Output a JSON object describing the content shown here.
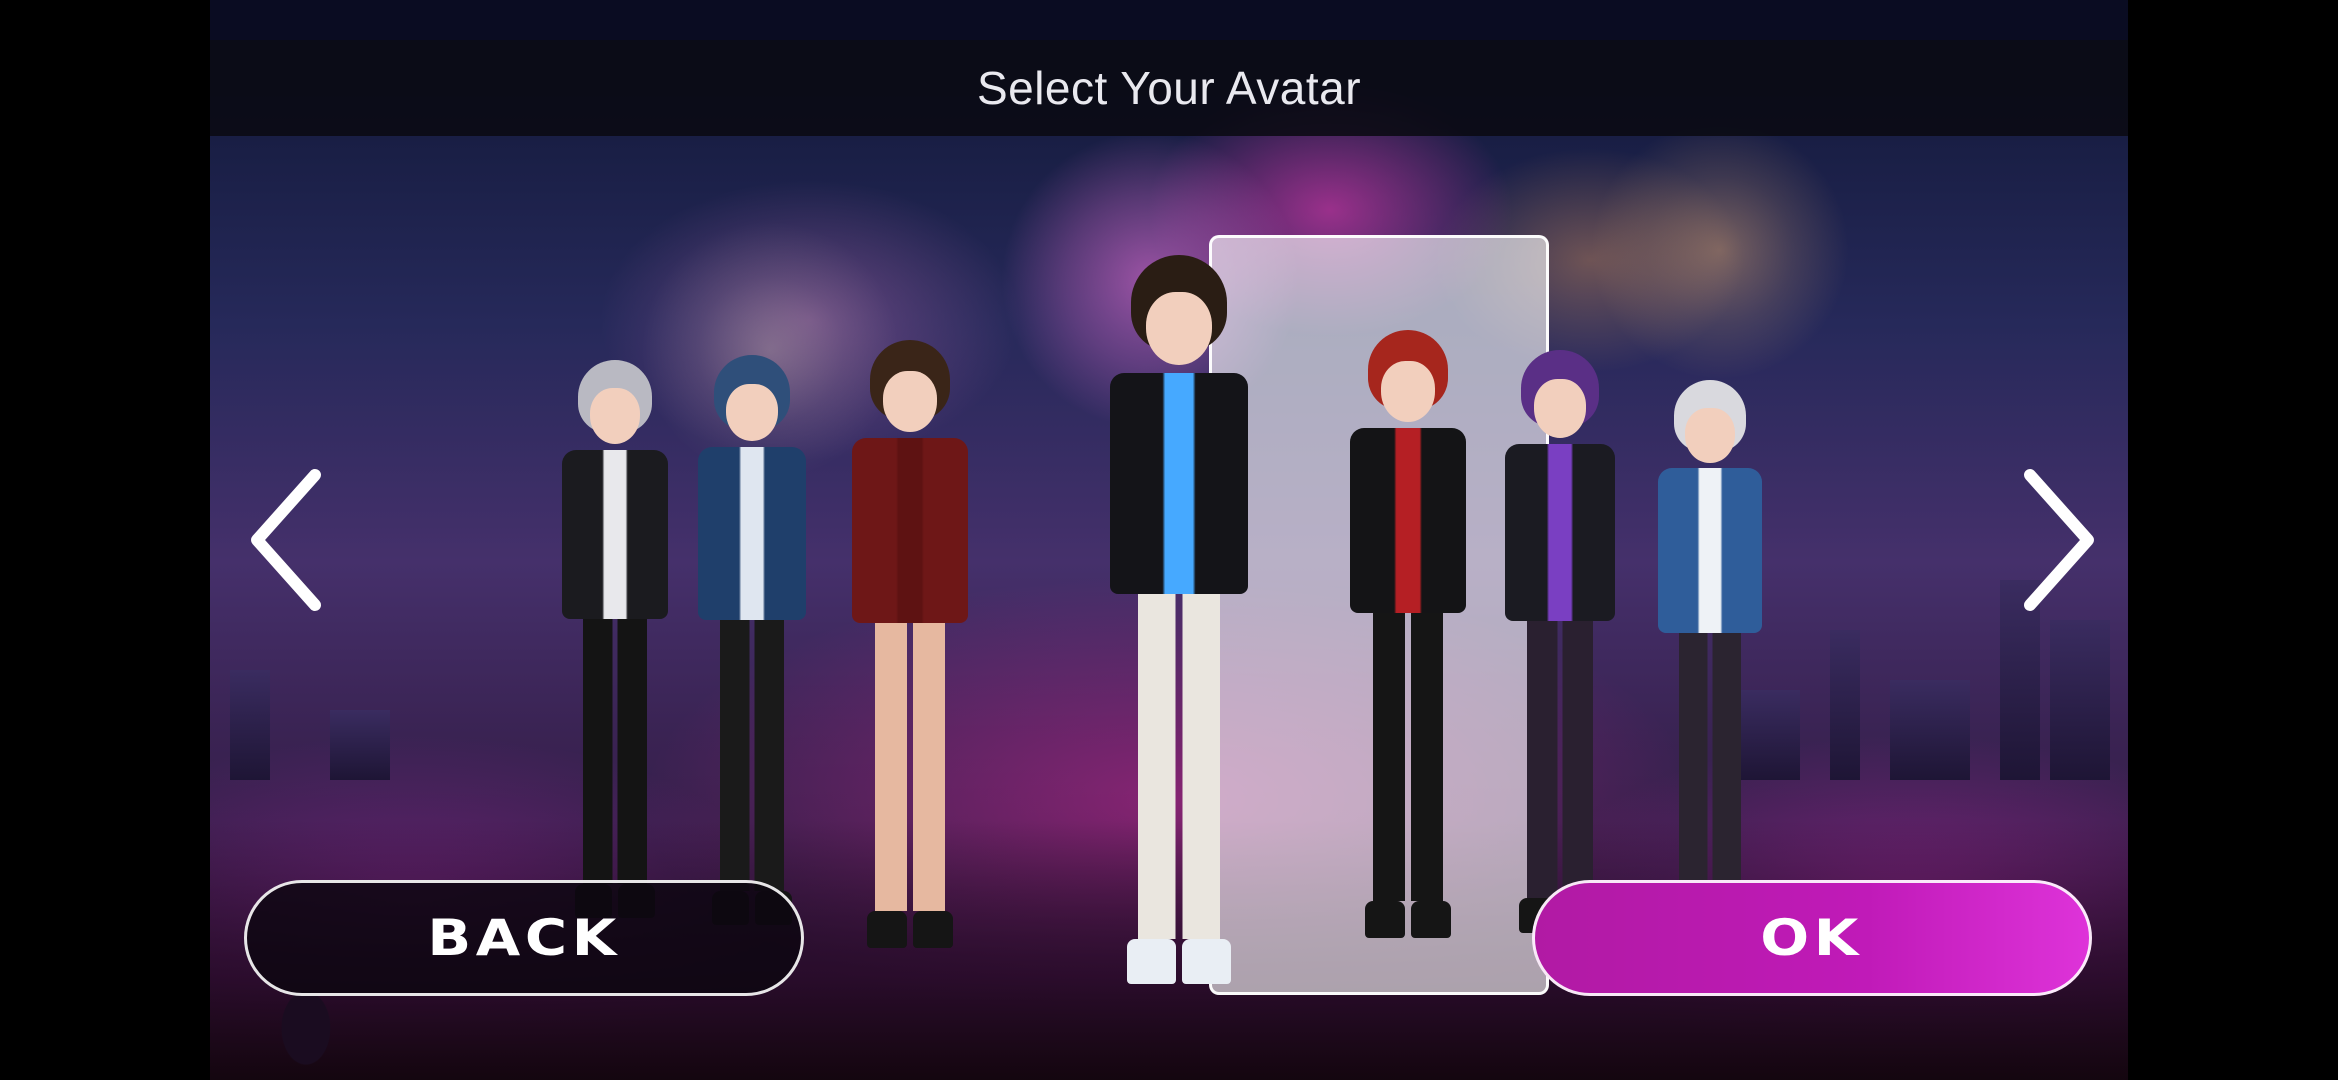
{
  "header": {
    "title": "Select Your Avatar"
  },
  "navigation": {
    "prev_icon": "chevron-left-icon",
    "next_icon": "chevron-right-icon"
  },
  "avatars": [
    {
      "name": "avatar-silver-hair-boy",
      "hair": "#b9b9c2",
      "top": "#1b1b1f",
      "legs": "#141414",
      "accent": "#e8e8ec"
    },
    {
      "name": "avatar-blue-hair-girl",
      "hair": "#2f4f7a",
      "top": "#1f3f6b",
      "legs": "#1a1a1a",
      "accent": "#dfe6f0"
    },
    {
      "name": "avatar-brown-hair-girl",
      "hair": "#3a2518",
      "top": "#6e1717",
      "legs": "#e6b8a0",
      "accent": "#5e1212"
    },
    {
      "name": "avatar-curly-hair-boy",
      "hair": "#2a1d14",
      "top": "#141418",
      "legs": "#eae6df",
      "accent": "#46a9ff",
      "selected": true
    },
    {
      "name": "avatar-red-hair-boy",
      "hair": "#a6261d",
      "top": "#141416",
      "legs": "#151515",
      "accent": "#b51f24"
    },
    {
      "name": "avatar-purple-hair-girl",
      "hair": "#5a2f86",
      "top": "#1b1b22",
      "legs": "#2a2030",
      "accent": "#7a3fc2"
    },
    {
      "name": "avatar-white-hair-girl",
      "hair": "#d9d9de",
      "top": "#2f5d9a",
      "legs": "#2b2430",
      "accent": "#eef2f6"
    }
  ],
  "buttons": {
    "back": "BACK",
    "ok": "OK"
  },
  "colors": {
    "accent": "#c01ab8",
    "frame": "#ffffff",
    "title_bar": "#0a0a12"
  }
}
